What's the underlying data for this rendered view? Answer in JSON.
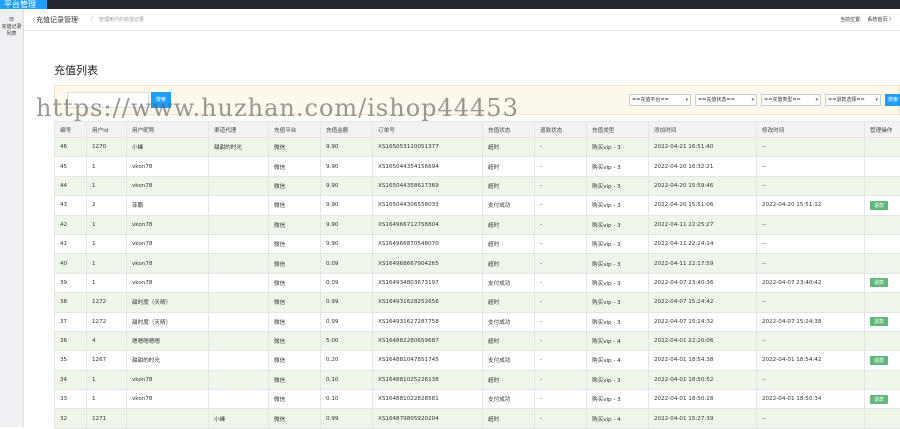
{
  "topbar": {
    "brand": "平台管理"
  },
  "sidebar": {
    "menu_icon": "≡",
    "item_label": "充值记录列表"
  },
  "breadcrumb": {
    "title": "充值记录管理",
    "sep": "/",
    "sub": "管理用户的充值记录",
    "position": "当前位置",
    "home": "系统首页 〉"
  },
  "page": {
    "title": "充值列表"
  },
  "filters": {
    "search_placeholder": "",
    "search_label": "搜索",
    "platform": "==充值平台==",
    "status": "==充值状态==",
    "type": "==充值类型==",
    "refund": "==退款选择==",
    "go_label": "搜索"
  },
  "watermark": "https://www.huzhan.com/ishop44453",
  "table": {
    "headers": [
      "编号",
      "用户id",
      "用户昵称",
      "渠道代理",
      "充值平台",
      "充值金额",
      "订单号",
      "充值状态",
      "退款状态",
      "充值类型",
      "添加时间",
      "修改时间",
      "管理操作"
    ],
    "rows": [
      {
        "id": "46",
        "uid": "1270",
        "nick": "小峰",
        "agent": "甜甜的时光",
        "platform": "微信",
        "amount": "9.90",
        "order": "XS165053110051377",
        "status": "超时",
        "status_kind": "timeout",
        "refund": "-",
        "type": "购买vip - 3",
        "added": "2022-04-21 16:51:40",
        "modified": "--",
        "op": ""
      },
      {
        "id": "45",
        "uid": "1",
        "nick": "vkon78",
        "agent": "",
        "platform": "微信",
        "amount": "9.90",
        "order": "XS165044354156694",
        "status": "超时",
        "status_kind": "timeout",
        "refund": "-",
        "type": "购买vip - 3",
        "added": "2022-04-20 16:32:21",
        "modified": "--",
        "op": ""
      },
      {
        "id": "44",
        "uid": "1",
        "nick": "vkon78",
        "agent": "",
        "platform": "微信",
        "amount": "9.90",
        "order": "XS165044358627369",
        "status": "超时",
        "status_kind": "timeout",
        "refund": "-",
        "type": "购买vip - 3",
        "added": "2022-04-20 15:59:46",
        "modified": "--",
        "op": ""
      },
      {
        "id": "43",
        "uid": "2",
        "nick": "菲鹏",
        "agent": "",
        "platform": "微信",
        "amount": "9.90",
        "order": "XS165044306558033",
        "status": "支付成功",
        "status_kind": "paid",
        "refund": "-",
        "type": "购买vip - 3",
        "added": "2022-04-20 15:51:06",
        "modified": "2022-04-20 15:51:12",
        "op": "退款"
      },
      {
        "id": "42",
        "uid": "1",
        "nick": "vkon78",
        "agent": "",
        "platform": "微信",
        "amount": "9.90",
        "order": "XS164966712758804",
        "status": "超时",
        "status_kind": "timeout",
        "refund": "-",
        "type": "购买vip - 3",
        "added": "2022-04-11 22:25:27",
        "modified": "--",
        "op": ""
      },
      {
        "id": "41",
        "uid": "1",
        "nick": "vkon78",
        "agent": "",
        "platform": "微信",
        "amount": "9.90",
        "order": "XS164966870548070",
        "status": "超时",
        "status_kind": "timeout",
        "refund": "-",
        "type": "购买vip - 3",
        "added": "2022-04-11 22:24:14",
        "modified": "--",
        "op": ""
      },
      {
        "id": "40",
        "uid": "1",
        "nick": "vkon78",
        "agent": "",
        "platform": "微信",
        "amount": "0.09",
        "order": "XS164968667904265",
        "status": "超时",
        "status_kind": "timeout",
        "refund": "-",
        "type": "购买vip - 3",
        "added": "2022-04-11 22:17:59",
        "modified": "--",
        "op": ""
      },
      {
        "id": "39",
        "uid": "1",
        "nick": "vkon78",
        "agent": "",
        "platform": "微信",
        "amount": "0.09",
        "order": "XS164934803673197",
        "status": "支付成功",
        "status_kind": "paid",
        "refund": "-",
        "type": "购买vip - 3",
        "added": "2022-04-07 23:40:36",
        "modified": "2022-04-07 23:40:42",
        "op": "退款"
      },
      {
        "id": "38",
        "uid": "1272",
        "nick": "甜时度（天晴）",
        "agent": "",
        "platform": "微信",
        "amount": "0.99",
        "order": "XS164931628252656",
        "status": "超时",
        "status_kind": "timeout",
        "refund": "-",
        "type": "购买vip - 3",
        "added": "2022-04-07 15:24:42",
        "modified": "--",
        "op": ""
      },
      {
        "id": "37",
        "uid": "1272",
        "nick": "甜时度（天晴）",
        "agent": "",
        "platform": "微信",
        "amount": "0.99",
        "order": "XS164931627287758",
        "status": "支付成功",
        "status_kind": "paid",
        "refund": "-",
        "type": "购买vip - 3",
        "added": "2022-04-07 15:24:32",
        "modified": "2022-04-07 15:24:38",
        "op": "退款"
      },
      {
        "id": "36",
        "uid": "4",
        "nick": "嗯嗯嗯嗯嗯",
        "agent": "",
        "platform": "微信",
        "amount": "5.00",
        "order": "XS164882280659687",
        "status": "超时",
        "status_kind": "timeout",
        "refund": "-",
        "type": "购买vip - 4",
        "added": "2022-04-01 22:20:06",
        "modified": "--",
        "op": ""
      },
      {
        "id": "35",
        "uid": "1267",
        "nick": "甜甜的时光",
        "agent": "",
        "platform": "微信",
        "amount": "0.20",
        "order": "XS164881047851745",
        "status": "支付成功",
        "status_kind": "paid",
        "refund": "-",
        "type": "购买vip - 4",
        "added": "2022-04-01 18:54:38",
        "modified": "2022-04-01 18:54:42",
        "op": "退款"
      },
      {
        "id": "34",
        "uid": "1",
        "nick": "vkon78",
        "agent": "",
        "platform": "微信",
        "amount": "0.10",
        "order": "XS164881025226138",
        "status": "超时",
        "status_kind": "timeout",
        "refund": "-",
        "type": "购买vip - 3",
        "added": "2022-04-01 18:50:52",
        "modified": "--",
        "op": ""
      },
      {
        "id": "33",
        "uid": "1",
        "nick": "vkon78",
        "agent": "",
        "platform": "微信",
        "amount": "0.10",
        "order": "XS164881022828581",
        "status": "支付成功",
        "status_kind": "paid",
        "refund": "-",
        "type": "购买vip - 3",
        "added": "2022-04-01 18:50:28",
        "modified": "2022-04-01 18:50:34",
        "op": "退款"
      },
      {
        "id": "32",
        "uid": "1271",
        "nick": "",
        "agent": "小峰",
        "platform": "微信",
        "amount": "0.99",
        "order": "XS164879805920204",
        "status": "超时",
        "status_kind": "timeout",
        "refund": "-",
        "type": "购买vip - 4",
        "added": "2022-04-01 15:27:39",
        "modified": "--",
        "op": ""
      }
    ]
  }
}
